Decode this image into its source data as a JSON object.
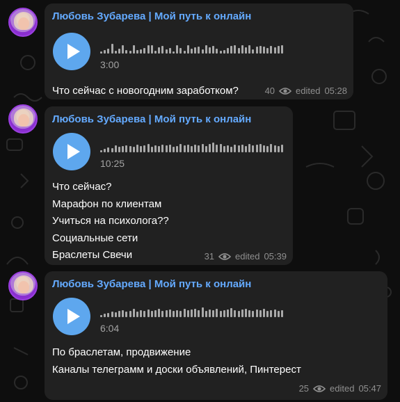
{
  "messages": [
    {
      "sender": "Любовь Зубарева | Мой путь к онлайн",
      "duration": "3:00",
      "lines": [
        "Что сейчас с новогодним заработком?"
      ],
      "views": "40",
      "edited": "edited",
      "time": "05:28"
    },
    {
      "sender": "Любовь Зубарева | Мой путь к онлайн",
      "duration": "10:25",
      "lines": [
        "Что сейчас?",
        "Марафон по клиентам",
        "Учиться на психолога??",
        "Социальные сети",
        "Браслеты Свечи"
      ],
      "views": "31",
      "edited": "edited",
      "time": "05:39"
    },
    {
      "sender": "Любовь Зубарева | Мой путь к онлайн",
      "duration": "6:04",
      "lines": [
        "По браслетам, продвижение",
        "Каналы телеграмм и доски объявлений, Пинтерест"
      ],
      "views": "25",
      "edited": "edited",
      "time": "05:47"
    }
  ],
  "colors": {
    "sender": "#64aaff",
    "play": "#5ea7ee",
    "bubble": "#212121"
  },
  "icons": {
    "play": "play-icon",
    "views": "eye-icon"
  }
}
